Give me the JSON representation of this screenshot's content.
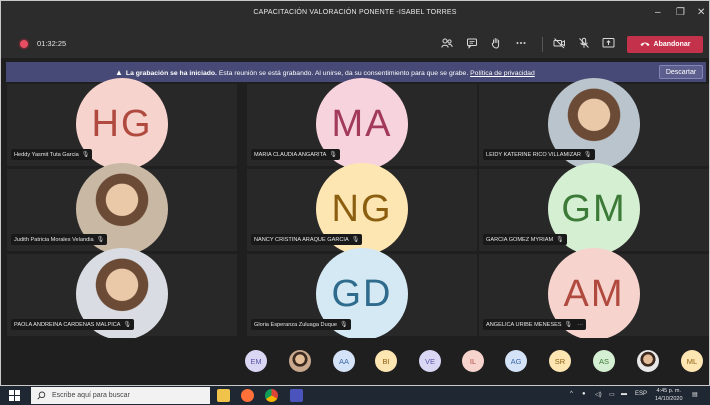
{
  "window": {
    "title": "CAPACITACIÓN VALORACIÓN PONENTE -ISABEL TORRES",
    "minimize_glyph": "–",
    "maximize_glyph": "❐",
    "close_glyph": "✕"
  },
  "controls": {
    "timer": "01:32:25",
    "leave_label": "Abandonar",
    "icons": [
      "participants-icon",
      "chat-icon",
      "raise-hand-icon",
      "more-icon",
      "camera-off-icon",
      "mic-off-icon",
      "share-screen-icon"
    ]
  },
  "banner": {
    "bold": "La grabación se ha iniciado.",
    "text": " Esta reunión se está grabando. Al unirse, da su consentimiento para que se grabe. ",
    "link": "Política de privacidad",
    "dismiss_label": "Descartar"
  },
  "participants": [
    {
      "initials": "HG",
      "name": "Heddy Yasmit Tuta Garcia",
      "color": "#f7d3cd",
      "text_color": "#b04a3f"
    },
    {
      "initials": "MA",
      "name": "MARIA CLAUDIA ANGARITA",
      "color": "#f7d3de",
      "text_color": "#a23a5a"
    },
    {
      "initials": "",
      "name": "LEIDY KATERINE RICO VILLAMIZAR",
      "photo": true,
      "color": "#b9c4cc"
    },
    {
      "initials": "",
      "name": "Judith Patricia Morales Velandia",
      "photo": true,
      "color": "#c9b8a4"
    },
    {
      "initials": "NG",
      "name": "NANCY CRISTINA ARAQUE GARCIA",
      "color": "#fde6b2",
      "text_color": "#8c5f10"
    },
    {
      "initials": "GM",
      "name": "GARCIA GOMEZ MYRIAM",
      "color": "#d5efd2",
      "text_color": "#3c7a37"
    },
    {
      "initials": "",
      "name": "PAOLA ANDREINA CARDENAS MALPICA",
      "photo": true,
      "color": "#d9dde3"
    },
    {
      "initials": "GD",
      "name": "Gloria Esperanza Zuluaga Duque",
      "color": "#d4e9f4",
      "text_color": "#2e6b8c"
    },
    {
      "initials": "AM",
      "name": "ANGELICA URIBE MENESES",
      "color": "#f7d3cd",
      "text_color": "#b04a3f",
      "has_more": true
    }
  ],
  "strip": [
    {
      "initials": "EM",
      "color": "#d9d7f4",
      "text_color": "#5b58a8"
    },
    {
      "initials": "",
      "photo": true,
      "color": "#c9a98e"
    },
    {
      "initials": "AA",
      "color": "#d4e3f7",
      "text_color": "#3d68a8"
    },
    {
      "initials": "BI",
      "color": "#fde6b2",
      "text_color": "#8c5f10"
    },
    {
      "initials": "VE",
      "color": "#d9d7f4",
      "text_color": "#5b58a8"
    },
    {
      "initials": "IL",
      "color": "#f7d3cd",
      "text_color": "#b04a3f"
    },
    {
      "initials": "AG",
      "color": "#d4e3f7",
      "text_color": "#3d68a8"
    },
    {
      "initials": "SR",
      "color": "#fde6b2",
      "text_color": "#8c5f10"
    },
    {
      "initials": "AS",
      "color": "#d5efd2",
      "text_color": "#3c7a37"
    },
    {
      "initials": "",
      "photo": true,
      "color": "#e8e8e8"
    },
    {
      "initials": "ML",
      "color": "#fde6b2",
      "text_color": "#8c5f10"
    }
  ],
  "taskbar": {
    "search_placeholder": "Escribe aquí para buscar",
    "lang": "ESP",
    "time": "4:45 p. m.",
    "date": "14/10/2020"
  }
}
